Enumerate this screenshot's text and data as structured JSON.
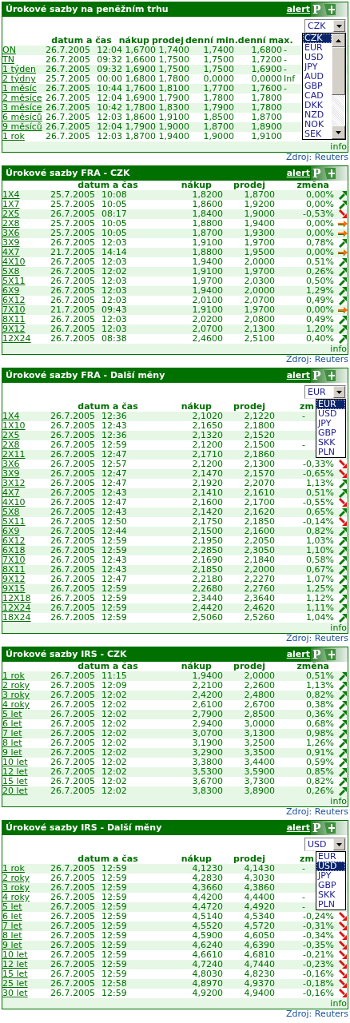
{
  "panels": [
    {
      "kind": "money_market",
      "title": "Úrokové sazby na peněžním trhu",
      "alert": "alert",
      "logo_letter": "P",
      "select": {
        "value": "CZK",
        "scrollbar": true,
        "options": [
          {
            "label": "CZK",
            "selected": true
          },
          {
            "label": "EUR",
            "selected": false
          },
          {
            "label": "USD",
            "selected": false
          },
          {
            "label": "JPY",
            "selected": false
          },
          {
            "label": "AUD",
            "selected": false
          },
          {
            "label": "GBP",
            "selected": false
          },
          {
            "label": "CAD",
            "selected": false
          },
          {
            "label": "DKK",
            "selected": false
          },
          {
            "label": "NZD",
            "selected": false
          },
          {
            "label": "NOK",
            "selected": false
          },
          {
            "label": "SEK",
            "selected": false
          }
        ]
      },
      "columns": [
        "datum a čas",
        "nákup",
        "prodej",
        "denní min.",
        "denní max."
      ],
      "rows": [
        {
          "term": "ON",
          "date": "26.7.2005",
          "time": "12:04",
          "buy": "1,6700",
          "sell": "1,7400",
          "min": "1,7400",
          "max": "1,6800",
          "column_7": "-"
        },
        {
          "term": "TN",
          "date": "26.7.2005",
          "time": "09:32",
          "buy": "1,6600",
          "sell": "1,7500",
          "min": "1,7500",
          "max": "1,7200",
          "column_7": "-"
        },
        {
          "term": "1 týden",
          "date": "26.7.2005",
          "time": "09:32",
          "buy": "1,6900",
          "sell": "1,7500",
          "min": "1,7500",
          "max": "1,6900",
          "column_7": "-"
        },
        {
          "term": "2 týdny",
          "date": "25.7.2005",
          "time": "00:00",
          "buy": "1,6800",
          "sell": "1,7800",
          "min": "0,0000",
          "max": "0,0000",
          "column_7": "Inf"
        },
        {
          "term": "1 měsíc",
          "date": "26.7.2005",
          "time": "10:44",
          "buy": "1,7600",
          "sell": "1,8100",
          "min": "1,7700",
          "max": "1,7600",
          "column_7": "-"
        },
        {
          "term": "2 měsíce",
          "date": "26.7.2005",
          "time": "12:04",
          "buy": "1,6900",
          "sell": "1,7900",
          "min": "1,7800",
          "max": "1,7800"
        },
        {
          "term": "3 měsíce",
          "date": "26.7.2005",
          "time": "10:42",
          "buy": "1,7800",
          "sell": "1,8300",
          "min": "1,7900",
          "max": "1,7800"
        },
        {
          "term": "6 měsíců",
          "date": "26.7.2005",
          "time": "12:03",
          "buy": "1,8600",
          "sell": "1,9100",
          "min": "1,8500",
          "max": "1,8700"
        },
        {
          "term": "9 měsíců",
          "date": "26.7.2005",
          "time": "12:04",
          "buy": "1,7900",
          "sell": "1,9000",
          "min": "1,8700",
          "max": "1,8900"
        },
        {
          "term": "1 rok",
          "date": "26.7.2005",
          "time": "12:03",
          "buy": "1,8700",
          "sell": "1,9400",
          "min": "1,9000",
          "max": "1,9100"
        }
      ],
      "info": "info",
      "source": "Zdroj: Reuters"
    },
    {
      "kind": "rates",
      "title": "Úrokové sazby FRA - CZK",
      "alert": "alert",
      "logo_letter": "P",
      "columns": [
        "datum a čas",
        "nákup",
        "prodej",
        "změna"
      ],
      "rows": [
        {
          "kind": "up",
          "term": "1X4",
          "date": "25.7.2005",
          "time": "10:08",
          "buy": "1,8200",
          "sell": "1,8700",
          "change": "0,00%"
        },
        {
          "kind": "up",
          "term": "1X7",
          "date": "25.7.2005",
          "time": "10:05",
          "buy": "1,8600",
          "sell": "1,9200",
          "change": "0,00%"
        },
        {
          "kind": "down",
          "term": "2X5",
          "date": "26.7.2005",
          "time": "08:17",
          "buy": "1,8400",
          "sell": "1,9000",
          "change": "-0,53%"
        },
        {
          "kind": "flat",
          "term": "2X8",
          "date": "25.7.2005",
          "time": "10:05",
          "buy": "1,8800",
          "sell": "1,9400",
          "change": "0,00%"
        },
        {
          "kind": "flat",
          "term": "3X6",
          "date": "25.7.2005",
          "time": "10:05",
          "buy": "1,8700",
          "sell": "1,9300",
          "change": "0,00%"
        },
        {
          "kind": "up",
          "term": "3X9",
          "date": "26.7.2005",
          "time": "12:03",
          "buy": "1,9100",
          "sell": "1,9700",
          "change": "0,78%"
        },
        {
          "kind": "flat",
          "term": "4X7",
          "date": "21.7.2005",
          "time": "14:14",
          "buy": "1,8800",
          "sell": "1,9500",
          "change": "0,00%"
        },
        {
          "kind": "up",
          "term": "4X10",
          "date": "26.7.2005",
          "time": "12:03",
          "buy": "1,9400",
          "sell": "2,0000",
          "change": "0,51%"
        },
        {
          "kind": "up",
          "term": "5X8",
          "date": "26.7.2005",
          "time": "12:02",
          "buy": "1,9100",
          "sell": "1,9700",
          "change": "0,26%"
        },
        {
          "kind": "up",
          "term": "5X11",
          "date": "26.7.2005",
          "time": "12:03",
          "buy": "1,9700",
          "sell": "2,0300",
          "change": "0,50%"
        },
        {
          "kind": "up",
          "term": "6X9",
          "date": "26.7.2005",
          "time": "12:03",
          "buy": "1,9400",
          "sell": "2,0000",
          "change": "1,29%"
        },
        {
          "kind": "up",
          "term": "6X12",
          "date": "26.7.2005",
          "time": "12:03",
          "buy": "2,0100",
          "sell": "2,0700",
          "change": "0,49%"
        },
        {
          "kind": "flat",
          "term": "7X10",
          "date": "21.7.2005",
          "time": "09:43",
          "buy": "1,9100",
          "sell": "1,9700",
          "change": "0,00%"
        },
        {
          "kind": "up",
          "term": "8X11",
          "date": "26.7.2005",
          "time": "12:03",
          "buy": "2,0200",
          "sell": "2,0800",
          "change": "0,49%"
        },
        {
          "kind": "up",
          "term": "9X12",
          "date": "26.7.2005",
          "time": "12:03",
          "buy": "2,0700",
          "sell": "2,1300",
          "change": "1,20%"
        },
        {
          "kind": "up",
          "term": "12X24",
          "date": "26.7.2005",
          "time": "08:38",
          "buy": "2,4600",
          "sell": "2,5100",
          "change": "0,40%"
        }
      ],
      "info": "info",
      "source": "Zdroj: Reuters"
    },
    {
      "kind": "rates",
      "title": "Úrokové sazby FRA - Další měny",
      "alert": "alert",
      "logo_letter": "P",
      "select": {
        "value": "EUR",
        "scrollbar": false,
        "options": [
          {
            "label": "EUR",
            "selected": true
          },
          {
            "label": "USD",
            "selected": false
          },
          {
            "label": "JPY",
            "selected": false
          },
          {
            "label": "GBP",
            "selected": false
          },
          {
            "label": "SKK",
            "selected": false
          },
          {
            "label": "PLN",
            "selected": false
          }
        ]
      },
      "columns": [
        "datum a čas",
        "nákup",
        "prodej",
        "zm"
      ],
      "rows": [
        {
          "kind": "covered",
          "term": "1X4",
          "date": "26.7.2005",
          "time": "12:36",
          "buy": "2,1020",
          "sell": "2,1220",
          "change": "-"
        },
        {
          "kind": "covered",
          "term": "1X10",
          "date": "26.7.2005",
          "time": "12:43",
          "buy": "2,1650",
          "sell": "2,1800"
        },
        {
          "kind": "covered",
          "term": "2X5",
          "date": "26.7.2005",
          "time": "12:36",
          "buy": "2,1320",
          "sell": "2,1520"
        },
        {
          "kind": "covered",
          "term": "2X8",
          "date": "26.7.2005",
          "time": "12:59",
          "buy": "2,1200",
          "sell": "2,1500",
          "change": "-"
        },
        {
          "kind": "covered",
          "term": "2X11",
          "date": "26.7.2005",
          "time": "12:47",
          "buy": "2,1710",
          "sell": "2,1860"
        },
        {
          "kind": "down",
          "term": "3X6",
          "date": "26.7.2005",
          "time": "12:57",
          "buy": "2,1200",
          "sell": "2,1300",
          "change": "-0,33%"
        },
        {
          "kind": "down",
          "term": "3X9",
          "date": "26.7.2005",
          "time": "12:47",
          "buy": "2,1470",
          "sell": "2,1570",
          "change": "-0,65%"
        },
        {
          "kind": "up",
          "term": "3X12",
          "date": "26.7.2005",
          "time": "12:47",
          "buy": "2,1920",
          "sell": "2,2070",
          "change": "1,13%"
        },
        {
          "kind": "up",
          "term": "4X7",
          "date": "26.7.2005",
          "time": "12:43",
          "buy": "2,1410",
          "sell": "2,1610",
          "change": "0,51%"
        },
        {
          "kind": "down",
          "term": "4X10",
          "date": "26.7.2005",
          "time": "12:47",
          "buy": "2,1600",
          "sell": "2,1700",
          "change": "-0,55%"
        },
        {
          "kind": "up",
          "term": "5X8",
          "date": "26.7.2005",
          "time": "12:43",
          "buy": "2,1420",
          "sell": "2,1620",
          "change": "0,65%"
        },
        {
          "kind": "down",
          "term": "5X11",
          "date": "26.7.2005",
          "time": "12:50",
          "buy": "2,1750",
          "sell": "2,1850",
          "change": "-0,14%"
        },
        {
          "kind": "up",
          "term": "6X9",
          "date": "26.7.2005",
          "time": "12:44",
          "buy": "2,1500",
          "sell": "2,1600",
          "change": "0,82%"
        },
        {
          "kind": "up",
          "term": "6X12",
          "date": "26.7.2005",
          "time": "12:59",
          "buy": "2,1950",
          "sell": "2,2050",
          "change": "1,03%"
        },
        {
          "kind": "up",
          "term": "6X18",
          "date": "26.7.2005",
          "time": "12:59",
          "buy": "2,2850",
          "sell": "2,3050",
          "change": "1,10%"
        },
        {
          "kind": "up",
          "term": "7X10",
          "date": "26.7.2005",
          "time": "12:43",
          "buy": "2,1690",
          "sell": "2,1840",
          "change": "0,58%"
        },
        {
          "kind": "up",
          "term": "8X11",
          "date": "26.7.2005",
          "time": "12:43",
          "buy": "2,1850",
          "sell": "2,2000",
          "change": "0,67%"
        },
        {
          "kind": "up",
          "term": "9X12",
          "date": "26.7.2005",
          "time": "12:47",
          "buy": "2,2180",
          "sell": "2,2270",
          "change": "1,07%"
        },
        {
          "kind": "up",
          "term": "9X15",
          "date": "26.7.2005",
          "time": "12:59",
          "buy": "2,2680",
          "sell": "2,2760",
          "change": "1,25%"
        },
        {
          "kind": "up",
          "term": "12X18",
          "date": "26.7.2005",
          "time": "12:59",
          "buy": "2,3440",
          "sell": "2,3640",
          "change": "1,12%"
        },
        {
          "kind": "up",
          "term": "12X24",
          "date": "26.7.2005",
          "time": "12:59",
          "buy": "2,4420",
          "sell": "2,4620",
          "change": "1,11%"
        },
        {
          "kind": "up",
          "term": "18X24",
          "date": "26.7.2005",
          "time": "12:59",
          "buy": "2,5060",
          "sell": "2,5260",
          "change": "1,04%"
        }
      ],
      "info": "info",
      "source": "Zdroj: Reuters"
    },
    {
      "kind": "rates",
      "title": "Úrokové sazby IRS - CZK",
      "alert": "alert",
      "logo_letter": "P",
      "columns": [
        "datum a čas",
        "nákup",
        "prodej",
        "změna"
      ],
      "rows": [
        {
          "kind": "up",
          "term": "1 rok",
          "date": "26.7.2005",
          "time": "11:15",
          "buy": "1,9400",
          "sell": "2,0000",
          "change": "0,51%"
        },
        {
          "kind": "up",
          "term": "2 roky",
          "date": "26.7.2005",
          "time": "12:09",
          "buy": "2,2100",
          "sell": "2,2600",
          "change": "1,13%"
        },
        {
          "kind": "up",
          "term": "3 roky",
          "date": "26.7.2005",
          "time": "12:02",
          "buy": "2,4200",
          "sell": "2,4800",
          "change": "0,82%"
        },
        {
          "kind": "up",
          "term": "4 roky",
          "date": "26.7.2005",
          "time": "12:02",
          "buy": "2,6100",
          "sell": "2,6700",
          "change": "0,38%"
        },
        {
          "kind": "up",
          "term": "5 let",
          "date": "26.7.2005",
          "time": "12:02",
          "buy": "2,7900",
          "sell": "2,8500",
          "change": "0,36%"
        },
        {
          "kind": "up",
          "term": "6 let",
          "date": "26.7.2005",
          "time": "12:02",
          "buy": "2,9400",
          "sell": "3,0000",
          "change": "0,68%"
        },
        {
          "kind": "up",
          "term": "7 let",
          "date": "26.7.2005",
          "time": "12:02",
          "buy": "3,0700",
          "sell": "3,1300",
          "change": "0,98%"
        },
        {
          "kind": "up",
          "term": "8 let",
          "date": "26.7.2005",
          "time": "12:02",
          "buy": "3,1900",
          "sell": "3,2500",
          "change": "1,26%"
        },
        {
          "kind": "up",
          "term": "9 let",
          "date": "26.7.2005",
          "time": "12:02",
          "buy": "3,2900",
          "sell": "3,3500",
          "change": "0,91%"
        },
        {
          "kind": "up",
          "term": "10 let",
          "date": "26.7.2005",
          "time": "12:02",
          "buy": "3,3800",
          "sell": "3,4400",
          "change": "0,59%"
        },
        {
          "kind": "up",
          "term": "12 let",
          "date": "26.7.2005",
          "time": "12:02",
          "buy": "3,5300",
          "sell": "3,5900",
          "change": "0,85%"
        },
        {
          "kind": "up",
          "term": "15 let",
          "date": "26.7.2005",
          "time": "12:02",
          "buy": "3,6700",
          "sell": "3,7300",
          "change": "0,82%"
        },
        {
          "kind": "up",
          "term": "20 let",
          "date": "26.7.2005",
          "time": "12:02",
          "buy": "3,8300",
          "sell": "3,8900",
          "change": "0,26%"
        }
      ],
      "info": "info",
      "source": "Zdroj: Reuters"
    },
    {
      "kind": "rates",
      "title": "Úrokové sazby IRS - Další měny",
      "alert": "alert",
      "logo_letter": "P",
      "select": {
        "value": "USD",
        "scrollbar": false,
        "options": [
          {
            "label": "EUR",
            "selected": false
          },
          {
            "label": "USD",
            "selected": true
          },
          {
            "label": "JPY",
            "selected": false
          },
          {
            "label": "GBP",
            "selected": false
          },
          {
            "label": "SKK",
            "selected": false
          },
          {
            "label": "PLN",
            "selected": false
          }
        ]
      },
      "columns": [
        "datum a čas",
        "nákup",
        "prodej",
        "zm"
      ],
      "rows": [
        {
          "kind": "covered",
          "term": "1 rok",
          "date": "26.7.2005",
          "time": "12:59",
          "buy": "4,1230",
          "sell": "4,1430",
          "change": "-"
        },
        {
          "kind": "covered",
          "term": "2 roky",
          "date": "26.7.2005",
          "time": "12:59",
          "buy": "4,2830",
          "sell": "4,3030"
        },
        {
          "kind": "covered",
          "term": "3 roky",
          "date": "26.7.2005",
          "time": "12:59",
          "buy": "4,3660",
          "sell": "4,3860"
        },
        {
          "kind": "covered",
          "term": "4 roky",
          "date": "26.7.2005",
          "time": "12:59",
          "buy": "4,4200",
          "sell": "4,4400",
          "change": "-"
        },
        {
          "kind": "covered",
          "term": "5 let",
          "date": "26.7.2005",
          "time": "12:59",
          "buy": "4,4720",
          "sell": "4,4920",
          "change": "-"
        },
        {
          "kind": "down",
          "term": "6 let",
          "date": "26.7.2005",
          "time": "12:59",
          "buy": "4,5140",
          "sell": "4,5340",
          "change": "-0,24%"
        },
        {
          "kind": "down",
          "term": "7 let",
          "date": "26.7.2005",
          "time": "12:59",
          "buy": "4,5520",
          "sell": "4,5720",
          "change": "-0,31%"
        },
        {
          "kind": "down",
          "term": "8 let",
          "date": "26.7.2005",
          "time": "12:59",
          "buy": "4,5900",
          "sell": "4,6050",
          "change": "-0,34%"
        },
        {
          "kind": "down",
          "term": "9 let",
          "date": "26.7.2005",
          "time": "12:59",
          "buy": "4,6240",
          "sell": "4,6390",
          "change": "-0,35%"
        },
        {
          "kind": "down",
          "term": "10 let",
          "date": "26.7.2005",
          "time": "12:59",
          "buy": "4,6610",
          "sell": "4,6810",
          "change": "-0,21%"
        },
        {
          "kind": "down",
          "term": "12 let",
          "date": "26.7.2005",
          "time": "12:59",
          "buy": "4,7240",
          "sell": "4,7440",
          "change": "-0,23%"
        },
        {
          "kind": "down",
          "term": "15 let",
          "date": "26.7.2005",
          "time": "12:59",
          "buy": "4,8030",
          "sell": "4,8230",
          "change": "-0,16%"
        },
        {
          "kind": "down",
          "term": "25 let",
          "date": "26.7.2005",
          "time": "12:58",
          "buy": "4,8970",
          "sell": "4,9370",
          "change": "-0,18%"
        },
        {
          "kind": "down",
          "term": "30 let",
          "date": "26.7.2005",
          "time": "12:59",
          "buy": "4,9200",
          "sell": "4,9400",
          "change": "-0,16%"
        }
      ],
      "info": "info",
      "source": "Zdroj: Reuters"
    }
  ]
}
